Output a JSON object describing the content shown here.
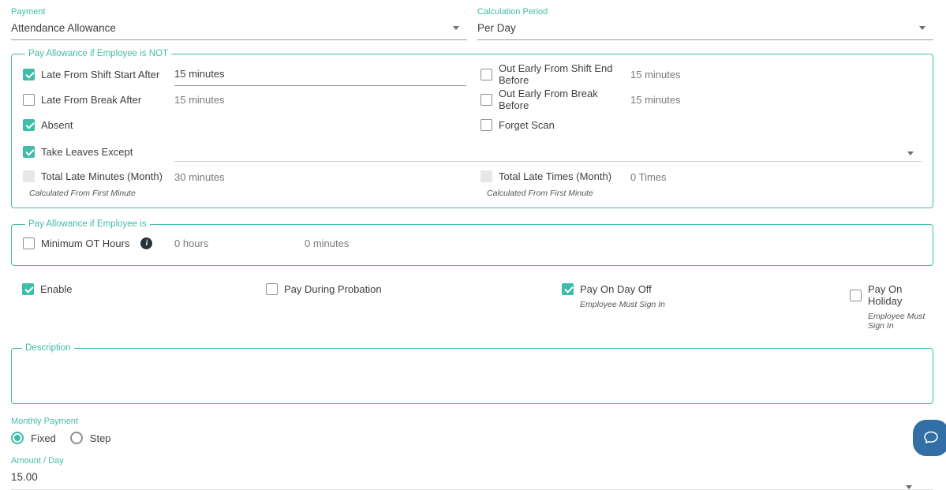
{
  "colors": {
    "accent": "#42bca8",
    "checkbox": "#3ebda8",
    "chat_button": "#336fa7"
  },
  "icons": {
    "dropdown_icon": "caret-down",
    "info_icon": "i",
    "chat_icon": "speech-bubble"
  },
  "fields": {
    "payment": {
      "label": "Payment",
      "value": "Attendance Allowance"
    },
    "calculation_period": {
      "label": "Calculation Period",
      "value": "Per Day"
    }
  },
  "not_section": {
    "legend": "Pay Allowance if Employee is NOT",
    "late_shift": {
      "label": "Late From Shift Start After",
      "checked": true,
      "value": "15 minutes"
    },
    "out_early_shift": {
      "label": "Out Early From Shift End Before",
      "checked": false,
      "value": "15 minutes"
    },
    "late_break": {
      "label": "Late From Break After",
      "checked": false,
      "value": "15 minutes"
    },
    "out_early_break": {
      "label": "Out Early From Break Before",
      "checked": false,
      "value": "15 minutes"
    },
    "absent": {
      "label": "Absent",
      "checked": true
    },
    "forget_scan": {
      "label": "Forget Scan",
      "checked": false
    },
    "take_leaves": {
      "label": "Take Leaves Except",
      "checked": true,
      "value": ""
    },
    "total_late_minutes": {
      "label": "Total Late Minutes (Month)",
      "disabled": true,
      "value": "30 minutes",
      "note": "Calculated From First Minute"
    },
    "total_late_times": {
      "label": "Total Late Times (Month)",
      "disabled": true,
      "value": "0 Times",
      "note": "Calculated From First Minute"
    }
  },
  "is_section": {
    "legend": "Pay Allowance if Employee is",
    "min_ot": {
      "label": "Minimum OT Hours",
      "checked": false,
      "hours": "0 hours",
      "minutes": "0 minutes"
    }
  },
  "options_row": {
    "enable": {
      "label": "Enable",
      "checked": true
    },
    "probation": {
      "label": "Pay During Probation",
      "checked": false
    },
    "day_off": {
      "label": "Pay On Day Off",
      "checked": true,
      "note": "Employee Must Sign In"
    },
    "holiday": {
      "label": "Pay On Holiday",
      "checked": false,
      "note": "Employee Must Sign In"
    }
  },
  "description": {
    "legend": "Description",
    "value": ""
  },
  "monthly_payment": {
    "label": "Monthly Payment",
    "options": [
      {
        "label": "Fixed",
        "selected": true
      },
      {
        "label": "Step",
        "selected": false
      }
    ]
  },
  "amount_per_day": {
    "label": "Amount / Day",
    "value": "15.00"
  }
}
